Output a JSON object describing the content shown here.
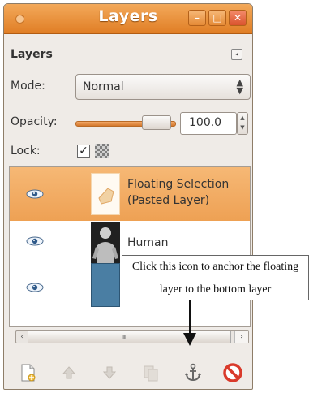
{
  "window": {
    "title": "Layers",
    "controls": {
      "minimize": "–",
      "maximize": "□",
      "close": "✕"
    }
  },
  "panel": {
    "title": "Layers",
    "menu_icon": "◂"
  },
  "mode": {
    "label": "Mode:",
    "value": "Normal"
  },
  "opacity": {
    "label": "Opacity:",
    "value": "100.0",
    "level_percent": 100
  },
  "lock": {
    "label": "Lock:",
    "checked": true
  },
  "layers": [
    {
      "name_line1": "Floating Selection",
      "name_line2": "(Pasted Layer)",
      "selected": true,
      "visible": true
    },
    {
      "name_line1": "Human",
      "name_line2": "",
      "selected": false,
      "visible": true
    },
    {
      "name_line1": "",
      "name_line2": "",
      "selected": false,
      "visible": true
    }
  ],
  "scrollbar": {
    "grip": "III"
  },
  "bottom_buttons": [
    "new-layer-icon",
    "raise-layer-icon",
    "lower-layer-icon",
    "duplicate-layer-icon",
    "anchor-icon",
    "delete-layer-icon"
  ],
  "callout": {
    "line1": "Click this icon to anchor the floating",
    "line2": "layer to the bottom layer"
  },
  "colors": {
    "titlebar": "#e8913c",
    "selection": "#f2ab62",
    "slider": "#e08a3e",
    "delete": "#d93a2b"
  }
}
